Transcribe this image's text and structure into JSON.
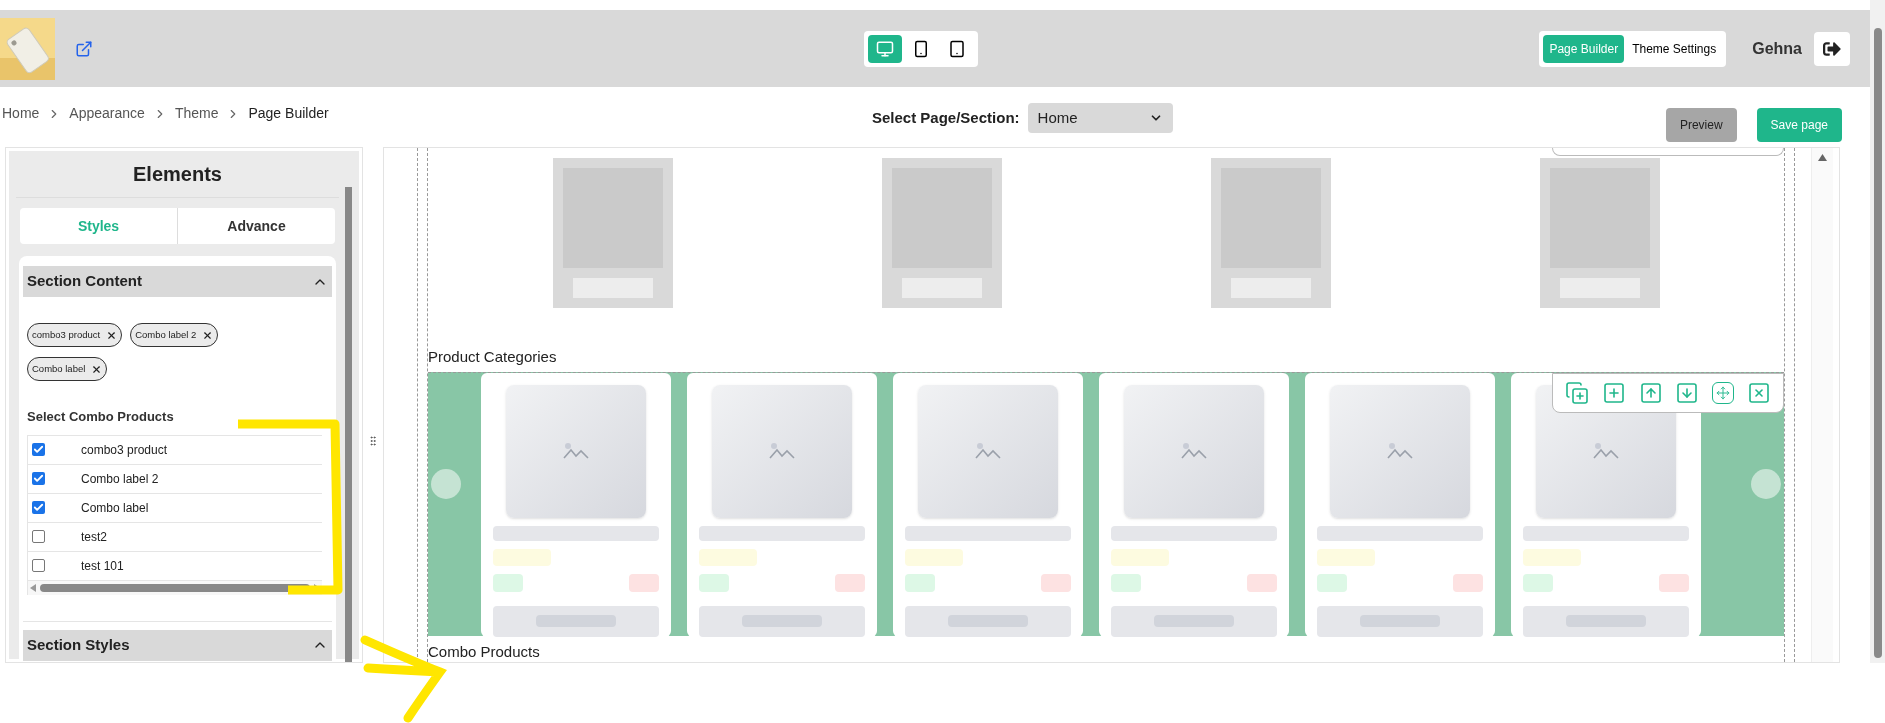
{
  "header": {
    "device_buttons": [
      {
        "kind": "desktop",
        "selected": true
      },
      {
        "kind": "phone",
        "selected": false
      },
      {
        "kind": "tablet",
        "selected": false
      }
    ],
    "mode_tabs": [
      {
        "label": "Page Builder",
        "selected": true
      },
      {
        "label": "Theme Settings",
        "selected": false
      }
    ],
    "user": "Gehna"
  },
  "breadcrumb": [
    "Home",
    "Appearance",
    "Theme",
    "Page Builder"
  ],
  "page_select": {
    "label": "Select Page/Section:",
    "value": "Home"
  },
  "actions": [
    {
      "label": "Preview",
      "kind": "secondary"
    },
    {
      "label": "Save page",
      "kind": "primary"
    }
  ],
  "panel": {
    "title": "Elements",
    "tabs": [
      {
        "label": "Styles",
        "selected": true
      },
      {
        "label": "Advance",
        "selected": false
      }
    ],
    "section_content": {
      "title": "Section Content",
      "expanded": true,
      "chips": [
        "combo3 product",
        "Combo label 2",
        "Combo label"
      ],
      "list_label": "Select Combo Products",
      "options": [
        {
          "label": "combo3 product",
          "checked": true
        },
        {
          "label": "Combo label 2",
          "checked": true
        },
        {
          "label": "Combo label",
          "checked": true
        },
        {
          "label": "test2",
          "checked": false
        },
        {
          "label": "test 101",
          "checked": false
        }
      ]
    },
    "section_styles": {
      "title": "Section Styles",
      "expanded": true
    }
  },
  "canvas": {
    "section_labels": [
      "Product Categories",
      "Combo Products"
    ]
  }
}
